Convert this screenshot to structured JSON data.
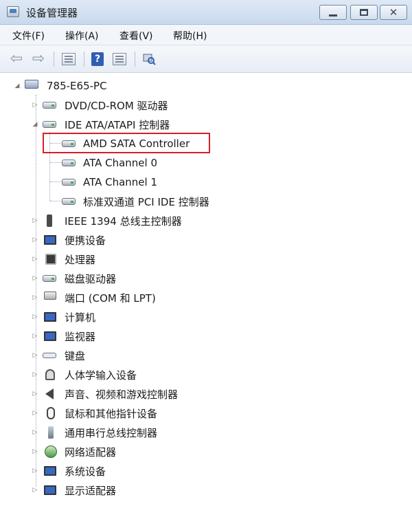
{
  "window": {
    "title": "设备管理器",
    "controls": {
      "minimize": "—",
      "maximize": "□",
      "close": "✕"
    }
  },
  "menu": [
    "文件(F)",
    "操作(A)",
    "查看(V)",
    "帮助(H)"
  ],
  "toolbar": {
    "buttons": [
      "back-arrow-icon",
      "forward-arrow-icon",
      "properties-icon",
      "help-icon",
      "list-icon",
      "scan-hardware-icon"
    ],
    "help_glyph": "?"
  },
  "tree": {
    "root": "785-E65-PC",
    "items": [
      {
        "label": "DVD/CD-ROM 驱动器",
        "expanded": false,
        "icon": "drive-icon"
      },
      {
        "label": "IDE ATA/ATAPI 控制器",
        "expanded": true,
        "icon": "drive-icon",
        "children": [
          {
            "label": "AMD SATA Controller",
            "highlighted": true
          },
          {
            "label": "ATA Channel 0"
          },
          {
            "label": "ATA Channel 1"
          },
          {
            "label": "标准双通道 PCI IDE 控制器"
          }
        ]
      },
      {
        "label": "IEEE 1394 总线主控制器",
        "expanded": false,
        "icon": "ieee1394-icon"
      },
      {
        "label": "便携设备",
        "expanded": false,
        "icon": "portable-device-icon"
      },
      {
        "label": "处理器",
        "expanded": false,
        "icon": "processor-icon"
      },
      {
        "label": "磁盘驱动器",
        "expanded": false,
        "icon": "disk-drive-icon"
      },
      {
        "label": "端口 (COM 和 LPT)",
        "expanded": false,
        "icon": "port-icon"
      },
      {
        "label": "计算机",
        "expanded": false,
        "icon": "computer-icon"
      },
      {
        "label": "监视器",
        "expanded": false,
        "icon": "monitor-icon"
      },
      {
        "label": "键盘",
        "expanded": false,
        "icon": "keyboard-icon"
      },
      {
        "label": "人体学输入设备",
        "expanded": false,
        "icon": "hid-icon"
      },
      {
        "label": "声音、视频和游戏控制器",
        "expanded": false,
        "icon": "sound-icon"
      },
      {
        "label": "鼠标和其他指针设备",
        "expanded": false,
        "icon": "mouse-icon"
      },
      {
        "label": "通用串行总线控制器",
        "expanded": false,
        "icon": "usb-icon"
      },
      {
        "label": "网络适配器",
        "expanded": false,
        "icon": "network-adapter-icon"
      },
      {
        "label": "系统设备",
        "expanded": false,
        "icon": "system-device-icon"
      },
      {
        "label": "显示适配器",
        "expanded": false,
        "icon": "display-adapter-icon"
      }
    ]
  },
  "colors": {
    "highlight_border": "#d41f2b",
    "titlebar": "#c9d9ee"
  }
}
